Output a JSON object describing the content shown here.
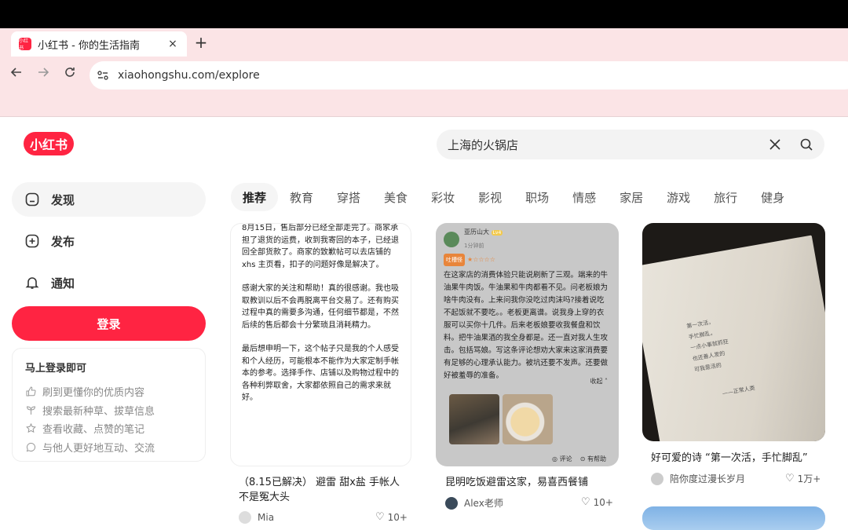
{
  "browser": {
    "tab_title": "小红书 - 你的生活指南",
    "tab_icon_text": "小红书",
    "tab_close": "×",
    "new_tab": "+",
    "url": "xiaohongshu.com/explore"
  },
  "header": {
    "logo": "小红书",
    "search_value": "上海的火锅店"
  },
  "sidebar": {
    "items": [
      {
        "label": "发现",
        "icon": "discover-icon",
        "active": true
      },
      {
        "label": "发布",
        "icon": "publish-icon",
        "active": false
      },
      {
        "label": "通知",
        "icon": "bell-icon",
        "active": false
      }
    ],
    "login_button": "登录",
    "login_card": {
      "title": "马上登录即可",
      "benefits": [
        {
          "text": "刷到更懂你的优质内容",
          "icon": "thumbs-up-icon"
        },
        {
          "text": "搜索最新种草、拔草信息",
          "icon": "sprout-icon"
        },
        {
          "text": "查看收藏、点赞的笔记",
          "icon": "star-icon"
        },
        {
          "text": "与他人更好地互动、交流",
          "icon": "chat-icon"
        }
      ]
    }
  },
  "categories": [
    "推荐",
    "教育",
    "穿搭",
    "美食",
    "彩妆",
    "影视",
    "职场",
    "情感",
    "家居",
    "游戏",
    "旅行",
    "健身"
  ],
  "feed": [
    {
      "paragraphs": [
        "8月15日，售后部分已经全部走完了。商家承担了退货的运费，收到我寄回的本子，已经退回全部货款了。商家的致歉帖可以去店铺的 xhs 主页看，扣子的问题好像是解决了。",
        "感谢大家的关注和帮助！真的很感谢。我也吸取教训以后不会再脱离平台交易了。还有购买过程中真的需要多沟通，任何细节都是，不然后续的售后都会十分繁琐且消耗精力。",
        "最后想申明一下，这个帖子只是我的个人感受和个人经历，可能根本不能作为大家定制手帐本的参考。选择手作、店铺以及购物过程中的各种利弊取舍，大家都依照自己的需求来就好。"
      ],
      "caption": "（8.15已解决） 避雷 甜x盐 手帐人不是冤大头",
      "author": "Mia",
      "likes": "10+"
    },
    {
      "review": {
        "name": "亚历山大",
        "level": "Lv4",
        "time": "1分钟前",
        "tag": "吐槽怪",
        "text": "在这家店的消费体验只能说刷新了三观。端来的牛油果牛肉饭。牛油果和牛肉都看不见。问老板娘为啥牛肉没有。上来问我你没吃过肉沫吗?接着说吃不起饭就不要吃。。老板更离谱。说我身上穿的衣服可以买你十几件。后来老板娘要收我餐盘和饮料。把牛油果酒的我全身都是。还一直对我人生攻击。包括骂娘。写这条评论想劝大家来这家消费要有足够的心理承认能力。被坑还要不发声。还要做好被羞辱的准备。",
        "fold": "收起",
        "comment": "评论",
        "helpful": "有帮助"
      },
      "caption": "昆明吃饭避雷这家，易喜西餐铺",
      "author": "Alex老师",
      "likes": "10+"
    },
    {
      "book_poem": [
        "第一次活，",
        "手忙脚乱，",
        "一点小事就抓狂",
        "也还善人发的",
        "可我是活的",
        "——正常人类"
      ],
      "caption": "好可爱的诗 “第一次活，手忙脚乱”",
      "author": "陪你度过漫长岁月",
      "likes": "1万+"
    }
  ]
}
